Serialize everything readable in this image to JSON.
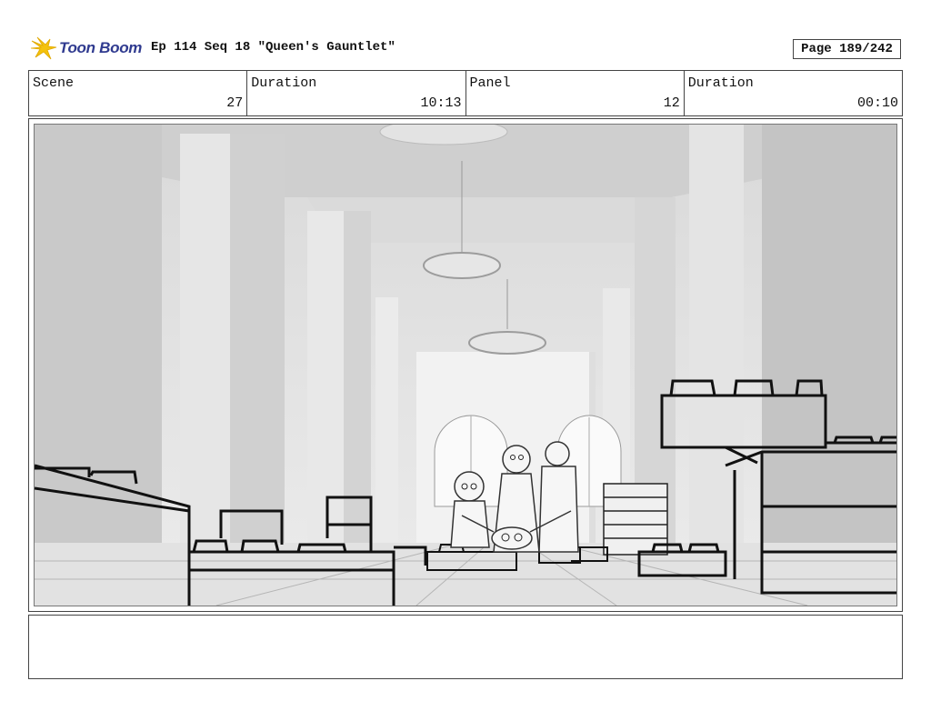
{
  "header": {
    "logo": {
      "brand": "Toon Boom",
      "icon": "toon-boom-star-icon",
      "color": "#2f3a8f",
      "accent": "#f4c20d"
    },
    "episode_title": "Ep 114 Seq 18 \"Queen's Gauntlet\"",
    "page": "Page 189/242"
  },
  "info": {
    "scene_label": "Scene",
    "scene_value": "27",
    "duration_label": "Duration",
    "duration_value": "10:13",
    "panel_label": "Panel",
    "panel_value": "12",
    "panel_duration_label": "Duration",
    "panel_duration_value": "00:10"
  },
  "panel": {
    "image": "storyboard-sketch-grand-hall-with-blocks-and-characters"
  },
  "notes": {
    "text": ""
  }
}
